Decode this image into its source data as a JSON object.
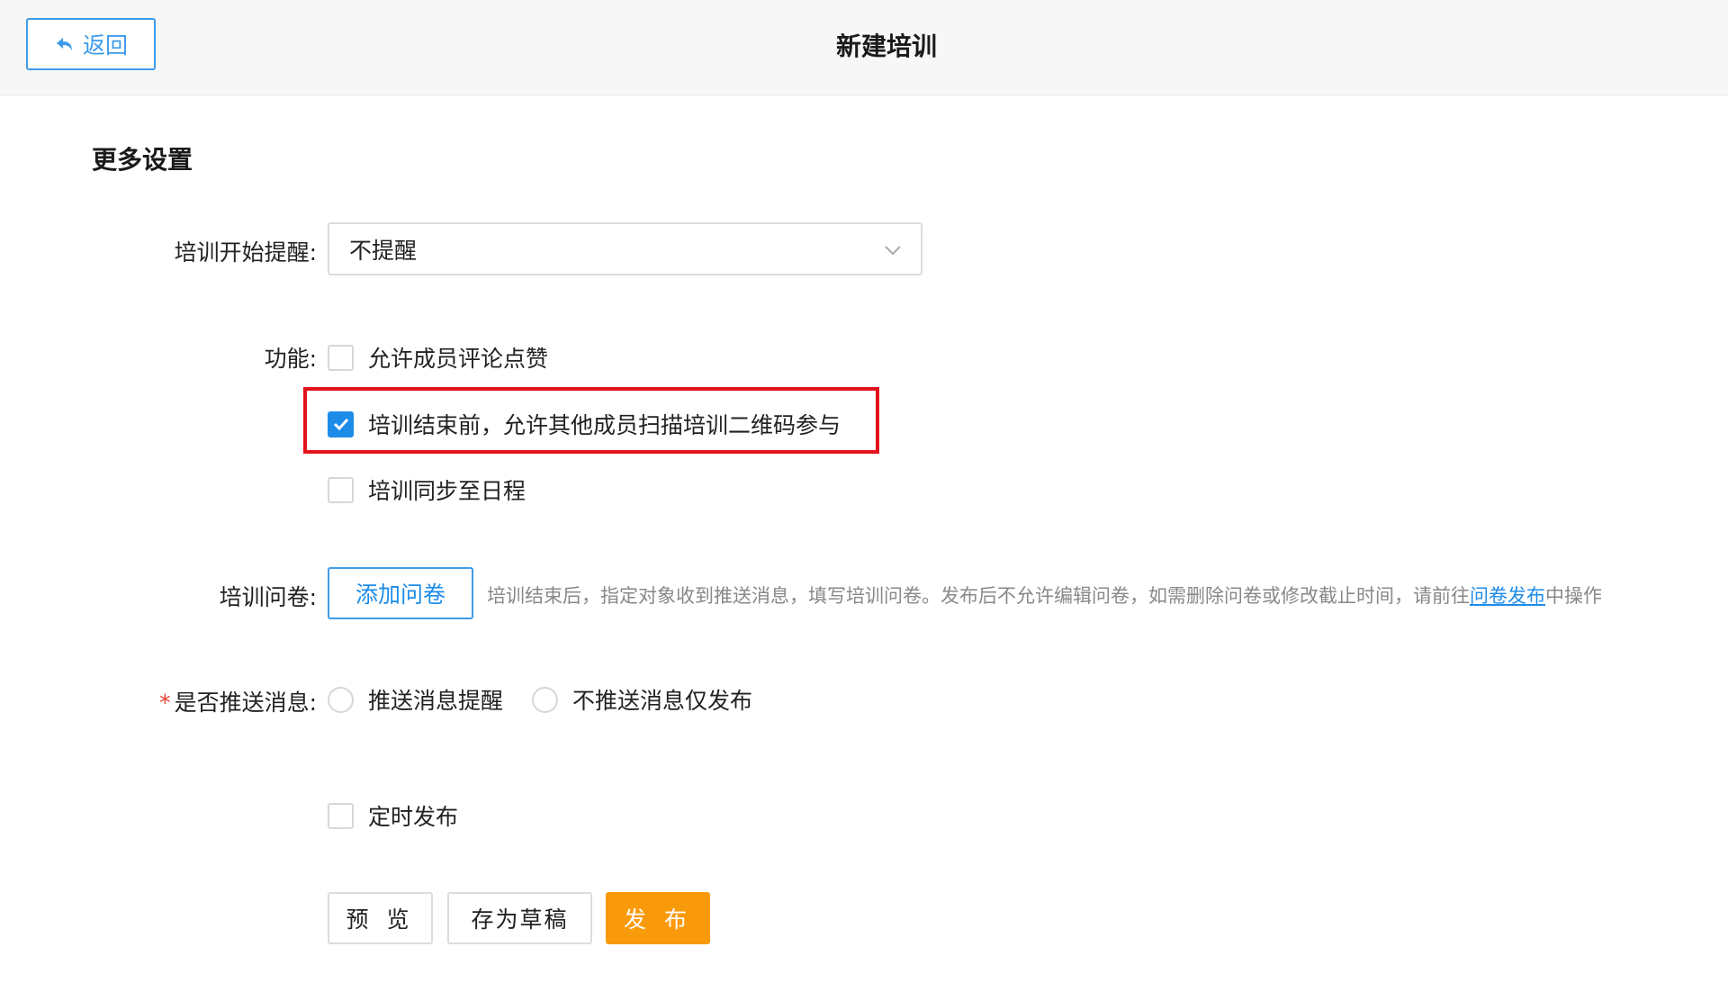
{
  "header": {
    "back_label": "返回",
    "title": "新建培训"
  },
  "section": {
    "title": "更多设置"
  },
  "reminder": {
    "label": "培训开始提醒:",
    "value": "不提醒"
  },
  "features": {
    "label": "功能:",
    "options": [
      {
        "label": "允许成员评论点赞",
        "checked": false
      },
      {
        "label": "培训结束前，允许其他成员扫描培训二维码参与",
        "checked": true
      },
      {
        "label": "培训同步至日程",
        "checked": false
      }
    ]
  },
  "survey": {
    "label": "培训问卷:",
    "button": "添加问卷",
    "hint_prefix": "培训结束后，指定对象收到推送消息，填写培训问卷。发布后不允许编辑问卷，如需删除问卷或修改截止时间，请前往",
    "hint_link": "问卷发布",
    "hint_suffix": "中操作"
  },
  "push": {
    "required_mark": "*",
    "label": "是否推送消息:",
    "options": [
      "推送消息提醒",
      "不推送消息仅发布"
    ]
  },
  "scheduled": {
    "label": "定时发布",
    "checked": false
  },
  "actions": {
    "preview": "预 览",
    "save_draft": "存为草稿",
    "publish": "发 布"
  },
  "colors": {
    "accent": "#1d8ce8",
    "publish": "#f99a0b",
    "highlight": "#e3121c"
  }
}
